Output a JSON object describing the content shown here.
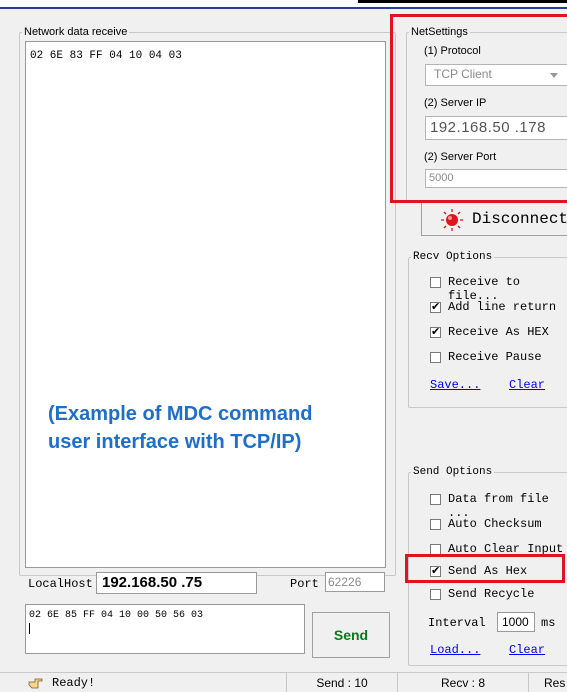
{
  "recv_group": {
    "title": "Network data receive",
    "content": "02 6E 83 FF 04 10 04 03"
  },
  "net_settings": {
    "title": "NetSettings",
    "protocol_label": "(1) Protocol",
    "protocol_value": "TCP Client",
    "server_ip_label": "(2) Server IP",
    "server_ip_value": "192.168.50 .178",
    "server_port_label": "(2) Server Port",
    "server_port_value": "5000",
    "disconnect_label": "Disconnect",
    "disconnect_icon": "record-red-icon"
  },
  "recv_options": {
    "title": "Recv Options",
    "items": [
      {
        "label": "Receive to file...",
        "checked": false
      },
      {
        "label": "Add line return",
        "checked": true
      },
      {
        "label": "Receive As HEX",
        "checked": true
      },
      {
        "label": "Receive Pause",
        "checked": false
      }
    ],
    "save_link": "Save...",
    "clear_link": "Clear"
  },
  "caption": {
    "line1": "(Example of MDC command",
    "line2": "user interface with TCP/IP)"
  },
  "send_options": {
    "title": "Send Options",
    "items": [
      {
        "label": "Data from file ...",
        "checked": false
      },
      {
        "label": "Auto Checksum",
        "checked": false
      },
      {
        "label": "Auto Clear Input",
        "checked": false
      },
      {
        "label": "Send As Hex",
        "checked": true
      },
      {
        "label": "Send Recycle",
        "checked": false
      }
    ],
    "interval_label": "Interval",
    "interval_value": "1000",
    "interval_unit": "ms",
    "load_link": "Load...",
    "clear_link": "Clear"
  },
  "local": {
    "host_label": "LocalHost",
    "host_value": "192.168.50 .75",
    "port_label": "Port",
    "port_value": "62226"
  },
  "send": {
    "content": "02 6E 85 FF 04 10 00 50 56 03",
    "button_label": "Send"
  },
  "status_bar": {
    "ready": "Ready!",
    "send_count": "Send : 10",
    "recv_count": "Recv : 8",
    "reset": "Res"
  },
  "colors": {
    "highlight_red": "#e0141e",
    "caption_blue": "#1e6fc9",
    "send_green": "#0a7a1a"
  }
}
